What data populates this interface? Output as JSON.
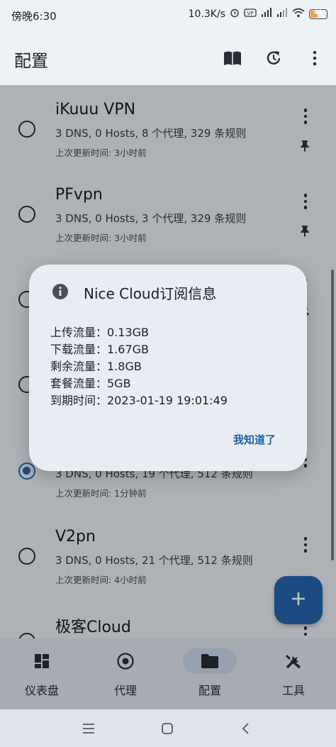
{
  "status_bar": {
    "time": "傍晚6:30",
    "net_speed": "10.3K/s",
    "battery": "41",
    "battery_level": 0.41
  },
  "app_bar": {
    "title": "配置",
    "icons": [
      "book-icon",
      "update-icon",
      "more-vert-icon"
    ]
  },
  "profiles": [
    {
      "name": "iKuuu VPN",
      "meta": "3 DNS, 0 Hosts, 8 个代理, 329 条规则",
      "updated": "上次更新时间: 3小时前",
      "selected": false,
      "pinned": true
    },
    {
      "name": "PFvpn",
      "meta": "3 DNS, 0 Hosts, 3 个代理, 329 条规则",
      "updated": "上次更新时间: 3小时前",
      "selected": false,
      "pinned": true
    },
    {
      "name": "",
      "meta": "",
      "updated": "",
      "selected": false,
      "pinned": true
    },
    {
      "name": "",
      "meta": "",
      "updated": "",
      "selected": false,
      "pinned": false
    },
    {
      "name": "",
      "meta": "3 DNS, 0 Hosts, 19 个代理, 512 条规则",
      "updated": "上次更新时间: 1分钟前",
      "selected": true,
      "pinned": false
    },
    {
      "name": "V2pn",
      "meta": "3 DNS, 0 Hosts, 21 个代理, 512 条规则",
      "updated": "上次更新时间: 4小时前",
      "selected": false,
      "pinned": false
    },
    {
      "name": "极客Cloud",
      "meta": "",
      "updated": "",
      "selected": false,
      "pinned": false
    }
  ],
  "fab": {
    "icon": "add-icon"
  },
  "bottom_nav": [
    {
      "label": "仪表盘",
      "icon": "dashboard-icon",
      "active": false
    },
    {
      "label": "代理",
      "icon": "proxy-icon",
      "active": false
    },
    {
      "label": "配置",
      "icon": "folder-icon",
      "active": true
    },
    {
      "label": "工具",
      "icon": "tools-icon",
      "active": false
    }
  ],
  "dialog": {
    "icon": "info-icon",
    "title": "Nice Cloud订阅信息",
    "lines": [
      "上传流量：0.13GB",
      "下载流量：1.67GB",
      "剩余流量：1.8GB",
      "套餐流量：5GB",
      "到期时间：2023-01-19 19:01:49"
    ],
    "confirm_label": "我知道了"
  },
  "colors": {
    "accent": "#1f5fa8",
    "background": "#e9edf3",
    "dialog_bg": "#e8edf4"
  }
}
